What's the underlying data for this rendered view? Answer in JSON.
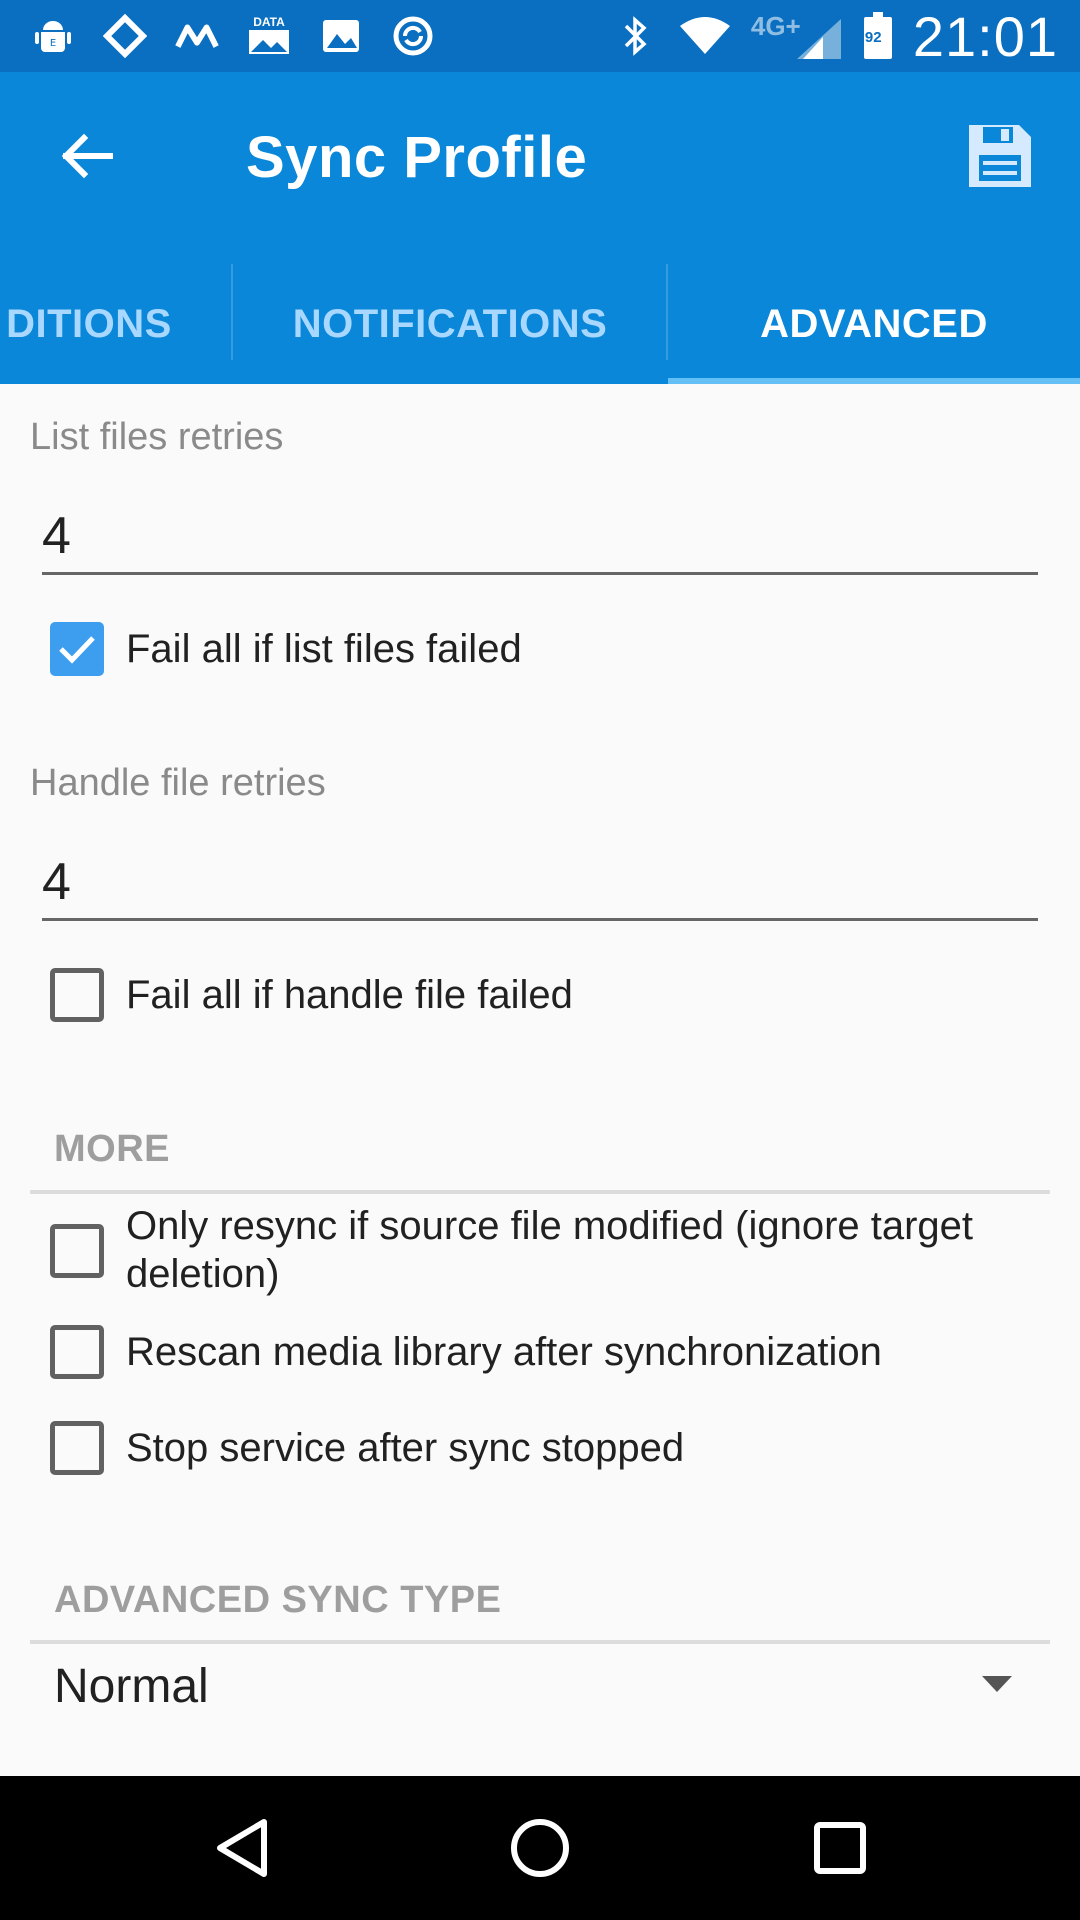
{
  "status_bar": {
    "time": "21:01",
    "network_type": "4G+",
    "battery_level": "92",
    "data_label": "DATA",
    "left_icons": [
      "android-debug-icon",
      "remote-icon",
      "m-icon",
      "data-icon",
      "image-icon",
      "sync-icon"
    ],
    "right_icons": [
      "bluetooth-icon",
      "wifi-icon",
      "signal-icon",
      "battery-icon"
    ]
  },
  "app_bar": {
    "title": "Sync Profile",
    "back_icon": "arrow-back-icon",
    "save_icon": "save-icon"
  },
  "tabs": [
    {
      "label": "CONDITIONS",
      "visible_label": "DITIONS",
      "active": false
    },
    {
      "label": "NOTIFICATIONS",
      "active": false
    },
    {
      "label": "ADVANCED",
      "active": true
    }
  ],
  "form": {
    "list_files_retries": {
      "label": "List files retries",
      "value": "4"
    },
    "fail_all_list_files": {
      "label": "Fail all if list files failed",
      "checked": true
    },
    "handle_file_retries": {
      "label": "Handle file retries",
      "value": "4"
    },
    "fail_all_handle_file": {
      "label": "Fail all if handle file failed",
      "checked": false
    }
  },
  "more_section": {
    "header": "MORE",
    "options": [
      {
        "label": "Only resync if source file modified (ignore target deletion)",
        "checked": false
      },
      {
        "label": "Rescan media library after synchronization",
        "checked": false
      },
      {
        "label": "Stop service after sync stopped",
        "checked": false
      }
    ]
  },
  "advanced_sync_type": {
    "header": "ADVANCED SYNC TYPE",
    "selected": "Normal"
  },
  "nav_bar": {
    "buttons": [
      "back-nav-icon",
      "home-nav-icon",
      "recents-nav-icon"
    ]
  },
  "colors": {
    "status_bar": "#0a6fc0",
    "app_bar": "#0a87d8",
    "tab_inactive": "#a8d8ff",
    "tab_indicator": "#64bff6",
    "checkbox_checked": "#3d9ef0",
    "background": "#fafafa"
  }
}
